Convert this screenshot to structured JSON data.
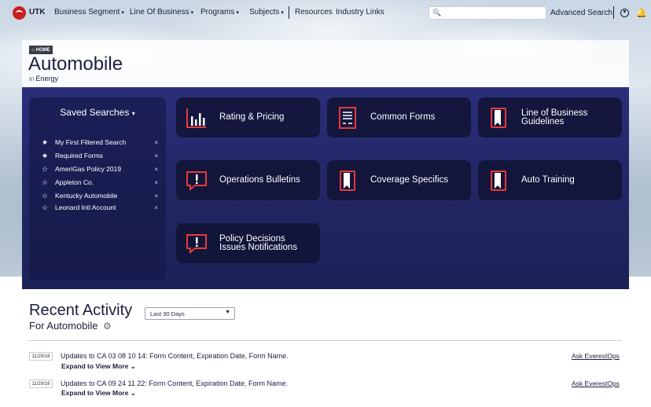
{
  "nav": {
    "brand": "UTK",
    "items": [
      {
        "label": "Business Segment",
        "caret": "▾"
      },
      {
        "label": "Line Of Business",
        "caret": "▾"
      },
      {
        "label": "Programs",
        "caret": "▾"
      },
      {
        "label": "Subjects",
        "caret": "▾"
      },
      {
        "label": "Resources",
        "caret": ""
      },
      {
        "label": "Industry Links",
        "caret": ""
      }
    ],
    "search_placeholder": "",
    "advanced_search": "Advanced Search"
  },
  "header": {
    "badge": "HOME",
    "title": "Automobile",
    "in_label": "in",
    "in_value": "Energy"
  },
  "saved_searches": {
    "title": "Saved Searches",
    "caret": "▾",
    "items": [
      {
        "label": "My First Filtered Search",
        "starred": true,
        "close": "×"
      },
      {
        "label": "Required Forms",
        "starred": true,
        "close": "×"
      },
      {
        "label": "AmeriGas Policy 2019",
        "starred": false,
        "close": "×"
      },
      {
        "label": "Appleton Co.",
        "starred": false,
        "close": "×"
      },
      {
        "label": "Kentucky Automobile",
        "starred": false,
        "close": "×"
      },
      {
        "label": "Leonard Intl Account",
        "starred": false,
        "close": "×"
      }
    ]
  },
  "tiles": [
    {
      "label": "Rating & Pricing",
      "icon": "bar-chart-icon"
    },
    {
      "label": "Common Forms",
      "icon": "document-icon"
    },
    {
      "label": "Line of Business Guidelines",
      "icon": "book-icon"
    },
    {
      "label": "Operations Bulletins",
      "icon": "alert-icon"
    },
    {
      "label": "Coverage Specifics",
      "icon": "book-icon"
    },
    {
      "label": "Auto Training",
      "icon": "book-icon"
    },
    {
      "label": "Policy Decisions Issues Notifications",
      "icon": "alert-icon"
    }
  ],
  "recent": {
    "title": "Recent Activity",
    "subtitle": "For Automobile",
    "filter": "Last 30 Days",
    "rows": [
      {
        "date": "11/29/18",
        "text": "Updates to CA 03 08 10 14: Form Content, Expiration Date, Form Name.",
        "expand": "Expand to View More",
        "link": "Ask EverestOps"
      },
      {
        "date": "11/29/18",
        "text": "Updates to CA 09 24 11 22: Form Content, Expiration Date, Form Name.",
        "expand": "Expand to View More",
        "link": "Ask EverestOps"
      }
    ]
  },
  "colors": {
    "accent": "#e63a3a",
    "panel": "#232766",
    "tile": "#10133a",
    "brand": "#c8201e"
  }
}
